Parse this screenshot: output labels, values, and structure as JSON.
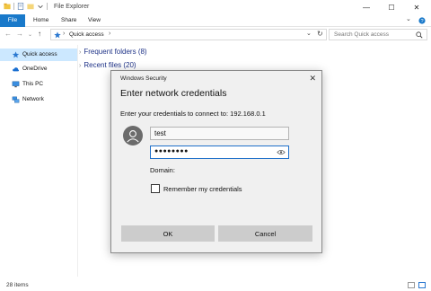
{
  "window": {
    "title": "File Explorer",
    "minimize": "—",
    "maximize": "☐",
    "close": "✕"
  },
  "ribbon": {
    "tabs": [
      "File",
      "Home",
      "Share",
      "View"
    ],
    "expand": "⌄",
    "help": "?"
  },
  "address": {
    "back": "←",
    "forward": "→",
    "recent": "⌄",
    "up": "↑",
    "path": "Quick access",
    "path_sep": "›",
    "dropdown": "⌄",
    "refresh": "↻",
    "search_placeholder": "Search Quick access"
  },
  "nav": {
    "items": [
      {
        "label": "Quick access",
        "icon": "star-icon",
        "selected": true
      },
      {
        "label": "OneDrive",
        "icon": "cloud-icon",
        "selected": false
      },
      {
        "label": "This PC",
        "icon": "computer-icon",
        "selected": false
      },
      {
        "label": "Network",
        "icon": "network-icon",
        "selected": false
      }
    ]
  },
  "content": {
    "groups": [
      {
        "label": "Frequent folders (8)"
      },
      {
        "label": "Recent files (20)"
      }
    ]
  },
  "status": {
    "items_count": "28 items"
  },
  "dialog": {
    "title": "Windows Security",
    "close": "✕",
    "heading": "Enter network credentials",
    "connect_text": "Enter your credentials to connect to: 192.168.0.1",
    "username": "test",
    "password_masked": "●●●●●●●●",
    "domain_label": "Domain:",
    "remember_label": "Remember my credentials",
    "remember_checked": false,
    "ok_label": "OK",
    "cancel_label": "Cancel"
  },
  "colors": {
    "accent": "#1979ca",
    "nav_selected": "#cce8ff",
    "link_blue": "#1e3287",
    "dialog_bg": "#f0f0f0",
    "button_bg": "#cccccc",
    "focus_border": "#1e6fc9"
  }
}
